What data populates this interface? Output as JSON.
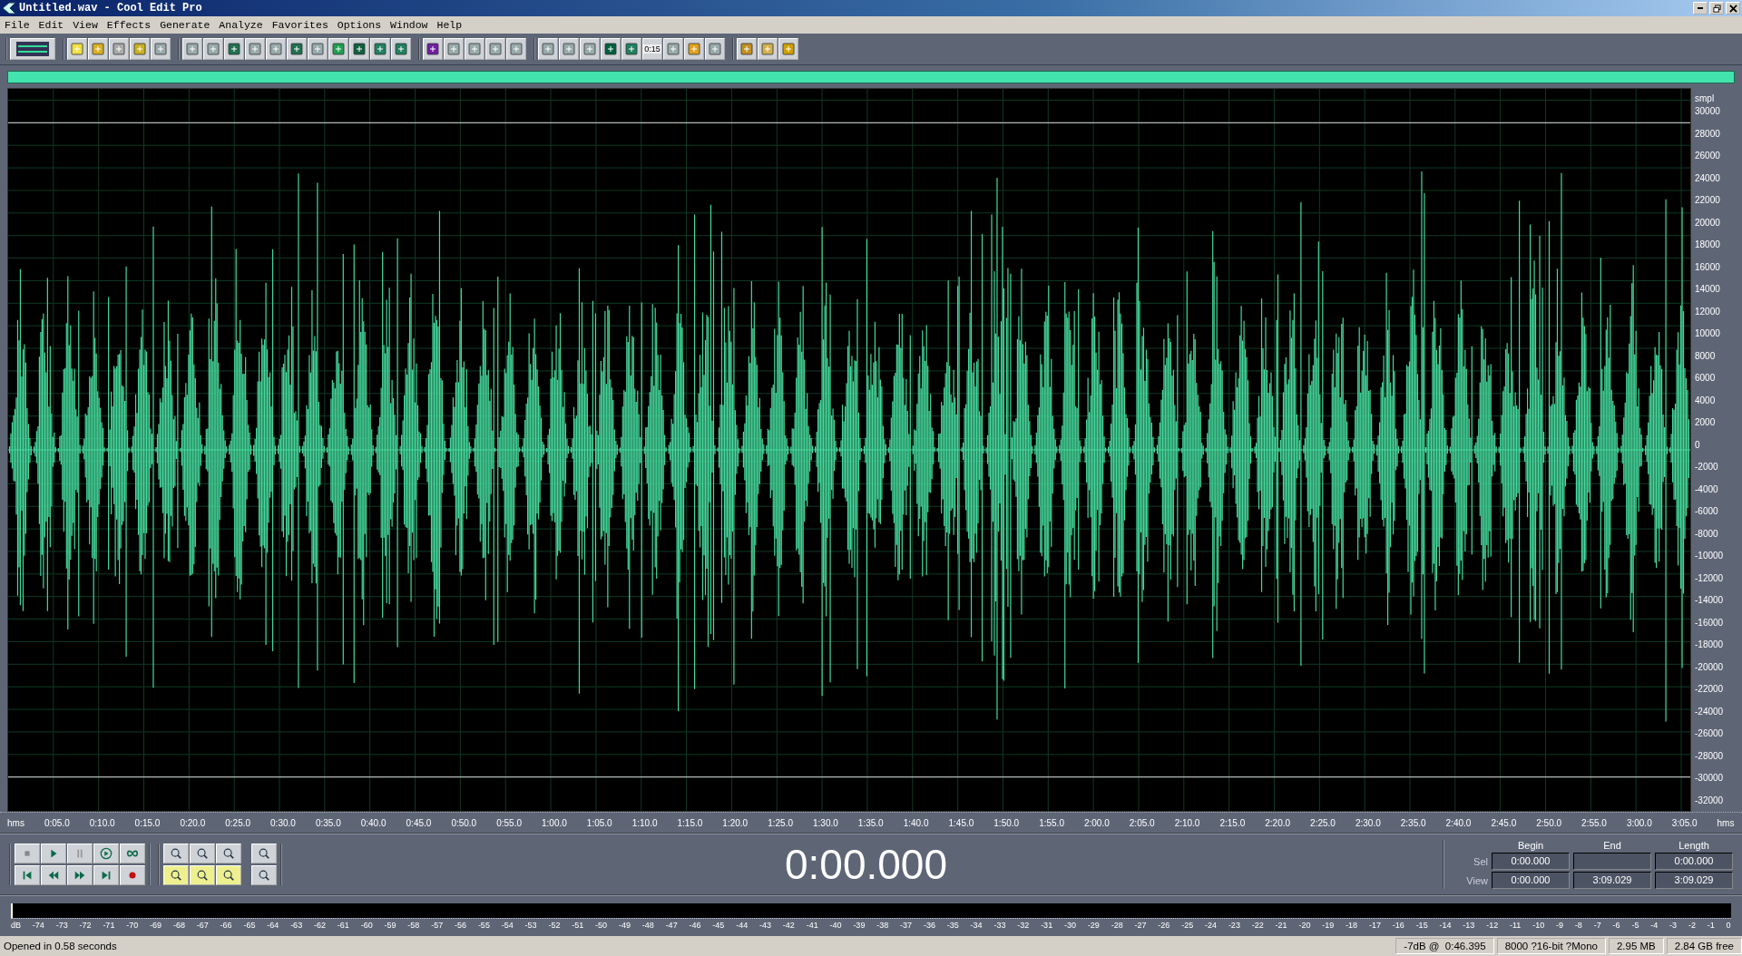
{
  "window": {
    "title": "Untitled.wav - Cool Edit Pro"
  },
  "menu": [
    "File",
    "Edit",
    "View",
    "Effects",
    "Generate",
    "Analyze",
    "Favorites",
    "Options",
    "Window",
    "Help"
  ],
  "toolbar": {
    "time_button_label": "0:15"
  },
  "amplitude_axis": {
    "unit": "smpl",
    "labels": [
      "30000",
      "28000",
      "26000",
      "24000",
      "22000",
      "20000",
      "18000",
      "16000",
      "14000",
      "12000",
      "10000",
      "8000",
      "6000",
      "4000",
      "2000",
      "0",
      "-2000",
      "-4000",
      "-6000",
      "-8000",
      "-10000",
      "-12000",
      "-14000",
      "-16000",
      "-18000",
      "-20000",
      "-22000",
      "-24000",
      "-26000",
      "-28000",
      "-30000",
      "-32000"
    ]
  },
  "time_axis": {
    "unit_left": "hms",
    "unit_right": "hms",
    "labels": [
      "0:05.0",
      "0:10.0",
      "0:15.0",
      "0:20.0",
      "0:25.0",
      "0:30.0",
      "0:35.0",
      "0:40.0",
      "0:45.0",
      "0:50.0",
      "0:55.0",
      "1:00.0",
      "1:05.0",
      "1:10.0",
      "1:15.0",
      "1:20.0",
      "1:25.0",
      "1:30.0",
      "1:35.0",
      "1:40.0",
      "1:45.0",
      "1:50.0",
      "1:55.0",
      "2:00.0",
      "2:05.0",
      "2:10.0",
      "2:15.0",
      "2:20.0",
      "2:25.0",
      "2:30.0",
      "2:35.0",
      "2:40.0",
      "2:45.0",
      "2:50.0",
      "2:55.0",
      "3:00.0",
      "3:05.0"
    ]
  },
  "time_display": "0:00.000",
  "selection": {
    "headers": [
      "Begin",
      "End",
      "Length"
    ],
    "rows": [
      {
        "label": "Sel",
        "begin": "0:00.000",
        "length": "0:00.000"
      },
      {
        "label": "View",
        "begin": "0:00.000",
        "end": "3:09.029",
        "length": "3:09.029"
      }
    ]
  },
  "level_meter": {
    "scale": [
      "dB",
      "-74",
      "-73",
      "-72",
      "-71",
      "-70",
      "-69",
      "-68",
      "-67",
      "-66",
      "-65",
      "-64",
      "-63",
      "-62",
      "-61",
      "-60",
      "-59",
      "-58",
      "-57",
      "-56",
      "-55",
      "-54",
      "-53",
      "-52",
      "-51",
      "-50",
      "-49",
      "-48",
      "-47",
      "-46",
      "-45",
      "-44",
      "-43",
      "-42",
      "-41",
      "-40",
      "-39",
      "-38",
      "-37",
      "-36",
      "-35",
      "-34",
      "-33",
      "-32",
      "-31",
      "-30",
      "-29",
      "-28",
      "-27",
      "-26",
      "-25",
      "-24",
      "-23",
      "-22",
      "-21",
      "-20",
      "-19",
      "-18",
      "-17",
      "-16",
      "-15",
      "-14",
      "-13",
      "-12",
      "-11",
      "-10",
      "-9",
      "-8",
      "-7",
      "-6",
      "-5",
      "-4",
      "-3",
      "-2",
      "-1",
      "0"
    ]
  },
  "status_bar": {
    "message": "Opened in 0.58 seconds",
    "cursor": "-7dB @  0:46.395",
    "format": "8000 ?16-bit ?Mono",
    "size": "2.95 MB",
    "free": "2.84 GB free"
  }
}
